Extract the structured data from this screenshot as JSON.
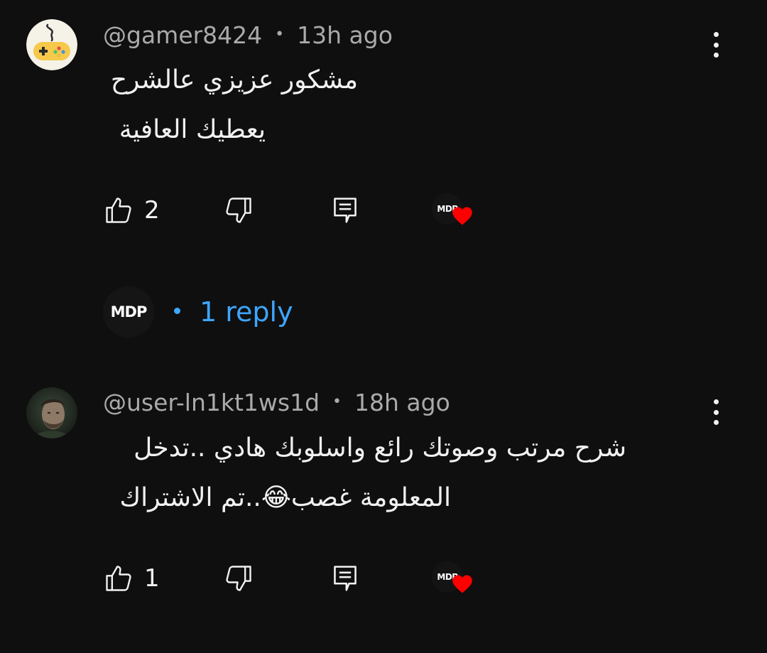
{
  "comments": [
    {
      "author": "@gamer8424",
      "separator": "•",
      "time": "13h ago",
      "lines": [
        "مشكور عزيزي عالشرح",
        "يعطيك العافية"
      ],
      "likes": "2",
      "avatar_icon": "gamepad-avatar-icon",
      "creator_heart_logo": "MDP"
    },
    {
      "author": "@user-ln1kt1ws1d",
      "separator": "•",
      "time": "18h ago",
      "lines": [
        "شرح مرتب وصوتك رائع واسلوبك هادي ..تدخل",
        "المعلومة غصب😂..تم الاشتراك"
      ],
      "likes": "1",
      "avatar_icon": "man-portrait-avatar",
      "creator_heart_logo": "MDP"
    }
  ],
  "reply": {
    "avatar_logo": "MDP",
    "separator": "•",
    "label": "1 reply"
  },
  "colors": {
    "background": "#0f0f0f",
    "text": "#f1f1f1",
    "meta": "#aaaaaa",
    "link": "#3ea6ff",
    "heart": "#ff0000",
    "gamepad_bg": "#f5f2e8",
    "gamepad_yellow": "#f6c94a"
  }
}
